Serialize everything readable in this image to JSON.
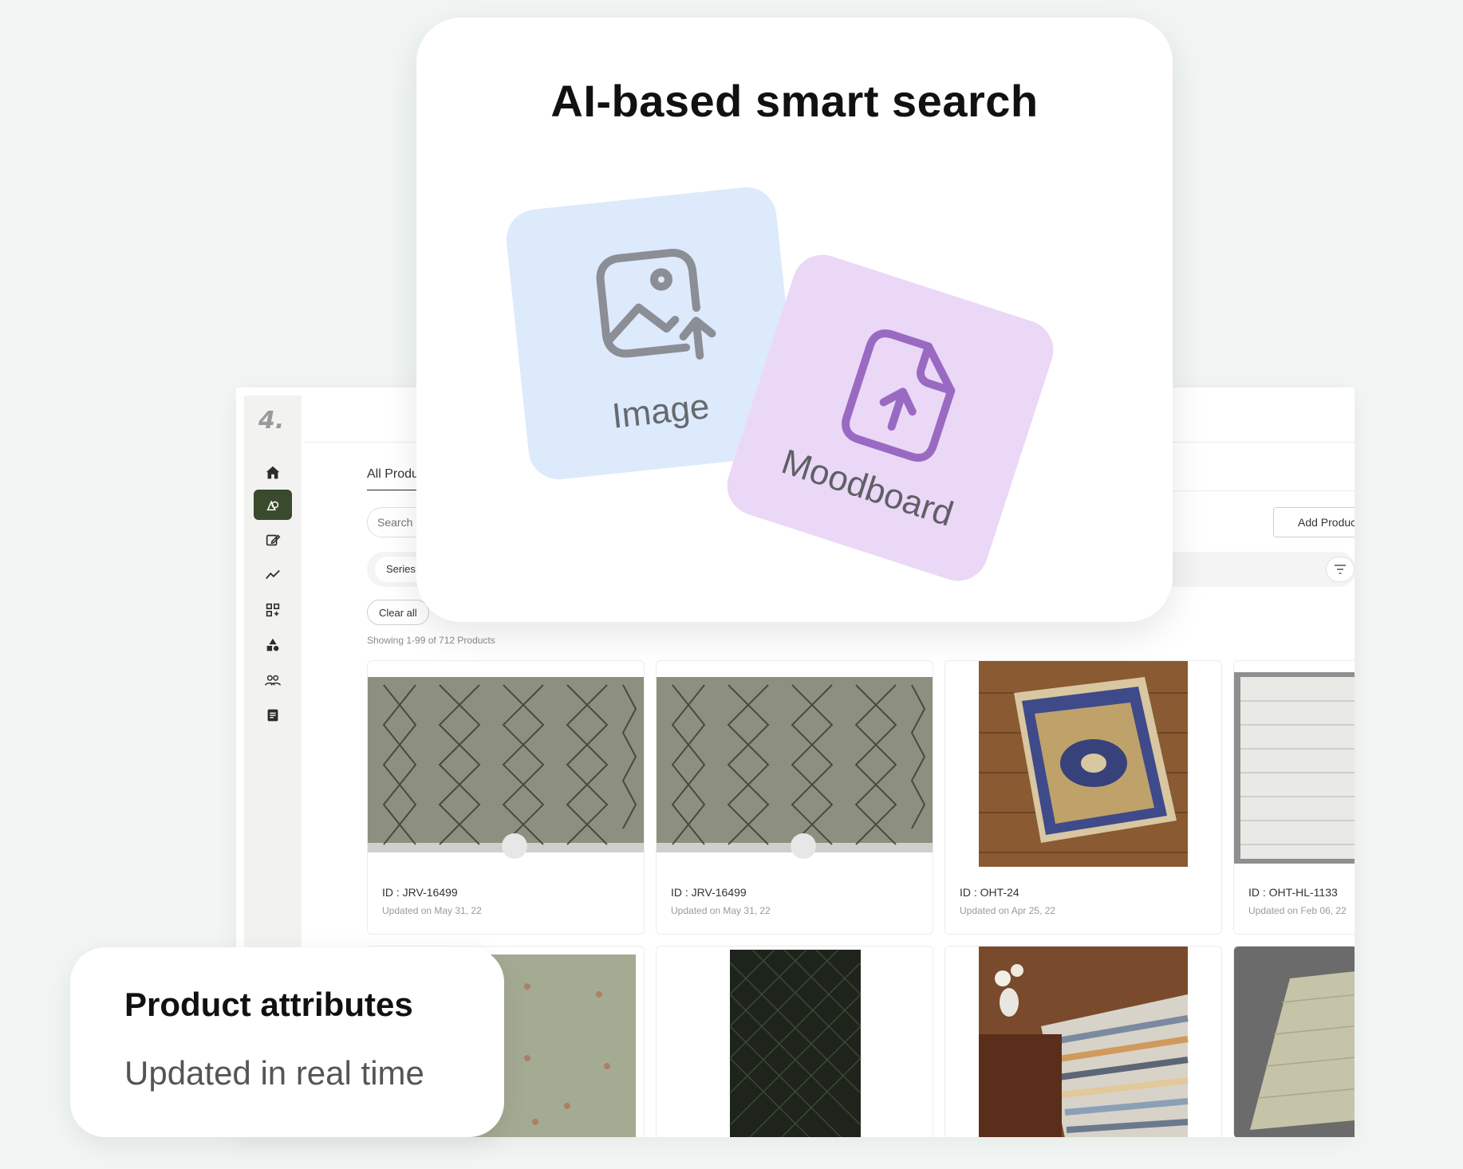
{
  "app": {
    "logo_text": "4.",
    "tab_label": "All Products",
    "search_placeholder": "Search Products",
    "add_button_label": "Add Product",
    "filter_chip_label": "Series",
    "clear_all_label": "Clear all",
    "showing_text": "Showing 1-99 of 712 Products",
    "nav_icons": [
      "home-icon",
      "shapes-icon",
      "edit-icon",
      "trend-icon",
      "grid-icon",
      "category-icon",
      "users-icon",
      "document-icon"
    ],
    "accent_color": "#3a4a2c",
    "products": [
      {
        "id": "ID : JRV-16499",
        "updated": "Updated on May 31, 22"
      },
      {
        "id": "ID : JRV-16499",
        "updated": "Updated on May 31, 22"
      },
      {
        "id": "ID : OHT-24",
        "updated": "Updated on Apr 25, 22"
      },
      {
        "id": "ID : OHT-HL-1133",
        "updated": "Updated on Feb 06, 22"
      }
    ]
  },
  "smart_search": {
    "title": "AI-based smart search",
    "image_label": "Image",
    "moodboard_label": "Moodboard",
    "image_tile_color": "#ddeafb",
    "moodboard_tile_color": "#ead8f6"
  },
  "attributes": {
    "title": "Product attributes",
    "subtitle": "Updated in real time"
  }
}
